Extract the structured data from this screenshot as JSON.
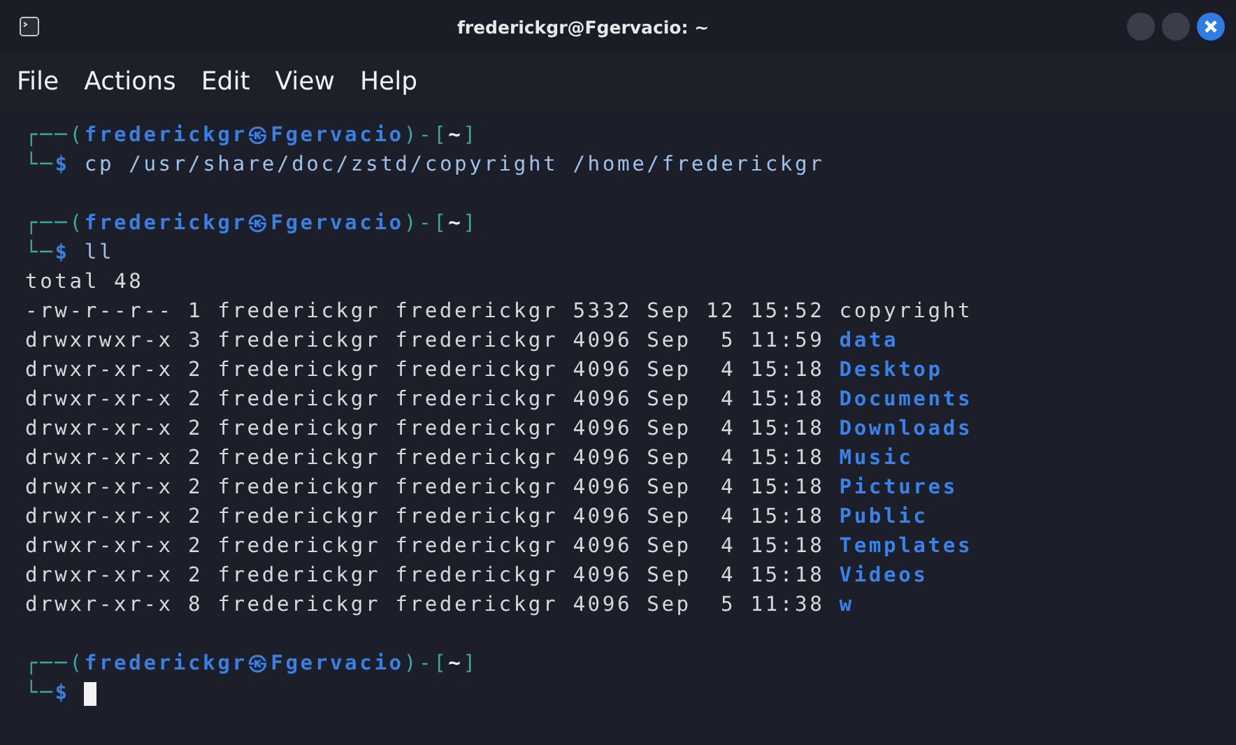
{
  "window": {
    "title": "frederickgr@Fgervacio: ~"
  },
  "menu": [
    "File",
    "Actions",
    "Edit",
    "View",
    "Help"
  ],
  "terminal": [
    {
      "kind": "prompt",
      "corner_top": "┌──(",
      "user_host": "frederickgr㉿Fgervacio",
      "bracket_open": ")-[",
      "dir": "~",
      "bracket_close": "]",
      "corner_bottom": "└─",
      "symbol": "$",
      "command": "cp /usr/share/doc/zstd/copyright /home/frederickgr"
    },
    {
      "kind": "prompt",
      "corner_top": "┌──(",
      "user_host": "frederickgr㉿Fgervacio",
      "bracket_open": ")-[",
      "dir": "~",
      "bracket_close": "]",
      "corner_bottom": "└─",
      "symbol": "$",
      "command": "ll"
    },
    {
      "kind": "output",
      "text": "total 48"
    },
    {
      "kind": "listing",
      "info": "-rw-r--r-- 1 frederickgr frederickgr 5332 Sep 12 15:52",
      "name": "copyright",
      "is_dir": false
    },
    {
      "kind": "listing",
      "info": "drwxrwxr-x 3 frederickgr frederickgr 4096 Sep  5 11:59",
      "name": "data",
      "is_dir": true
    },
    {
      "kind": "listing",
      "info": "drwxr-xr-x 2 frederickgr frederickgr 4096 Sep  4 15:18",
      "name": "Desktop",
      "is_dir": true
    },
    {
      "kind": "listing",
      "info": "drwxr-xr-x 2 frederickgr frederickgr 4096 Sep  4 15:18",
      "name": "Documents",
      "is_dir": true
    },
    {
      "kind": "listing",
      "info": "drwxr-xr-x 2 frederickgr frederickgr 4096 Sep  4 15:18",
      "name": "Downloads",
      "is_dir": true
    },
    {
      "kind": "listing",
      "info": "drwxr-xr-x 2 frederickgr frederickgr 4096 Sep  4 15:18",
      "name": "Music",
      "is_dir": true
    },
    {
      "kind": "listing",
      "info": "drwxr-xr-x 2 frederickgr frederickgr 4096 Sep  4 15:18",
      "name": "Pictures",
      "is_dir": true
    },
    {
      "kind": "listing",
      "info": "drwxr-xr-x 2 frederickgr frederickgr 4096 Sep  4 15:18",
      "name": "Public",
      "is_dir": true
    },
    {
      "kind": "listing",
      "info": "drwxr-xr-x 2 frederickgr frederickgr 4096 Sep  4 15:18",
      "name": "Templates",
      "is_dir": true
    },
    {
      "kind": "listing",
      "info": "drwxr-xr-x 2 frederickgr frederickgr 4096 Sep  4 15:18",
      "name": "Videos",
      "is_dir": true
    },
    {
      "kind": "listing",
      "info": "drwxr-xr-x 8 frederickgr frederickgr 4096 Sep  5 11:38",
      "name": "w",
      "is_dir": true
    },
    {
      "kind": "prompt",
      "corner_top": "┌──(",
      "user_host": "frederickgr㉿Fgervacio",
      "bracket_open": ")-[",
      "dir": "~",
      "bracket_close": "]",
      "corner_bottom": "└─",
      "symbol": "$"
    }
  ]
}
